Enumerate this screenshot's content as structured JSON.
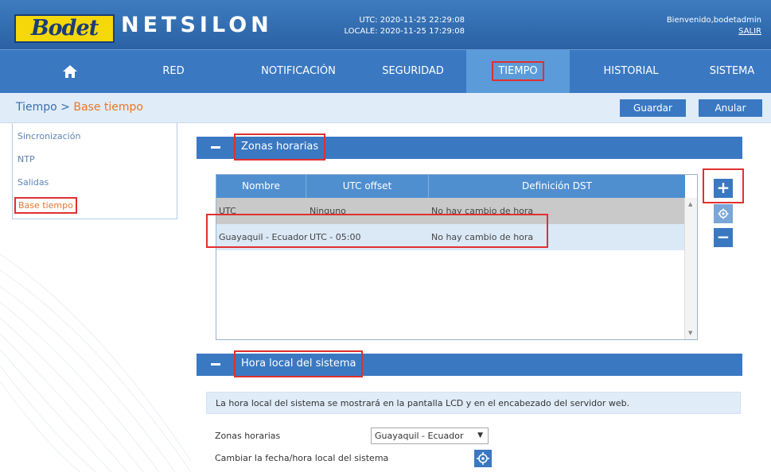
{
  "header": {
    "logo_text": "Bodet",
    "app_name": "NETSILON",
    "utc_time": "UTC: 2020-11-25 22:29:08",
    "local_time": "LOCALE: 2020-11-25 17:29:08",
    "welcome": "Bienvenido,bodetadmin",
    "logout": "SALIR"
  },
  "nav": {
    "home_icon": "home-icon",
    "items": [
      "RED",
      "NOTIFICACIÓN",
      "SEGURIDAD",
      "TIEMPO",
      "HISTORIAL",
      "SISTEMA"
    ],
    "active": "TIEMPO"
  },
  "breadcrumb": {
    "parent": "Tiempo",
    "separator": " > ",
    "current": "Base tiempo"
  },
  "actions": {
    "save": "Guardar",
    "cancel": "Anular"
  },
  "sidebar": {
    "items": [
      {
        "label": "Sincronización"
      },
      {
        "label": "NTP"
      },
      {
        "label": "Salidas"
      },
      {
        "label": "Base tiempo"
      }
    ],
    "active": "Base tiempo"
  },
  "timezones": {
    "title": "Zonas horarias",
    "columns": [
      "Nombre",
      "UTC offset",
      "Definición DST"
    ],
    "rows": [
      {
        "name": "UTC",
        "offset": "Ninguno",
        "dst": "No hay cambio de hora"
      },
      {
        "name": "Guayaquil - Ecuador",
        "offset": "UTC - 05:00",
        "dst": "No hay cambio de hora"
      }
    ],
    "buttons": {
      "add": "+",
      "edit_icon": "gear-icon",
      "remove": "−"
    }
  },
  "local_time": {
    "title": "Hora local del sistema",
    "info": "La hora local del sistema se mostrará en la pantalla LCD y en el encabezado del servidor web.",
    "timezone_label": "Zonas horarias",
    "timezone_value": "Guayaquil - Ecuador",
    "change_label": "Cambiar la fecha/hora local del sistema"
  },
  "colors": {
    "primary": "#3a78c2",
    "accent": "#e8762a",
    "highlight": "#e0302f",
    "logo_bg": "#f5d80a"
  }
}
